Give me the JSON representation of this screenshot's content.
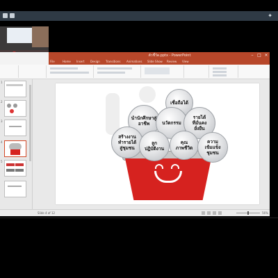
{
  "window": {
    "title": "ตัวชี้วัด.pptx - PowerPoint",
    "minimize": "–",
    "maximize": "□",
    "close": "×"
  },
  "ribbon": {
    "tabs": [
      "File",
      "Home",
      "Insert",
      "Design",
      "Transitions",
      "Animations",
      "Slide Show",
      "Review",
      "View"
    ]
  },
  "thumbnails": {
    "numbers": [
      "1",
      "2",
      "3",
      "4",
      "5"
    ]
  },
  "slide": {
    "bubbles": [
      "เชื่อถือได้",
      "นำนักศึกษาสู่อาชีพ",
      "นวัตกรรม",
      "รายได้\nที่มั่นคง\nยั่งยืน",
      "สร้างงาน\nทำรายได้\nสู่ชุมชน",
      "ลูก\nปฏิบัติงาน",
      "คุณ\nภาพชีวิต",
      "ความ\nเข้มแข็ง\nชุมชน"
    ]
  },
  "status": {
    "left_text": "Slide 4 of 12",
    "zoom": "56%"
  },
  "colors": {
    "accent": "#b7472a",
    "pot": "#d6221f"
  }
}
